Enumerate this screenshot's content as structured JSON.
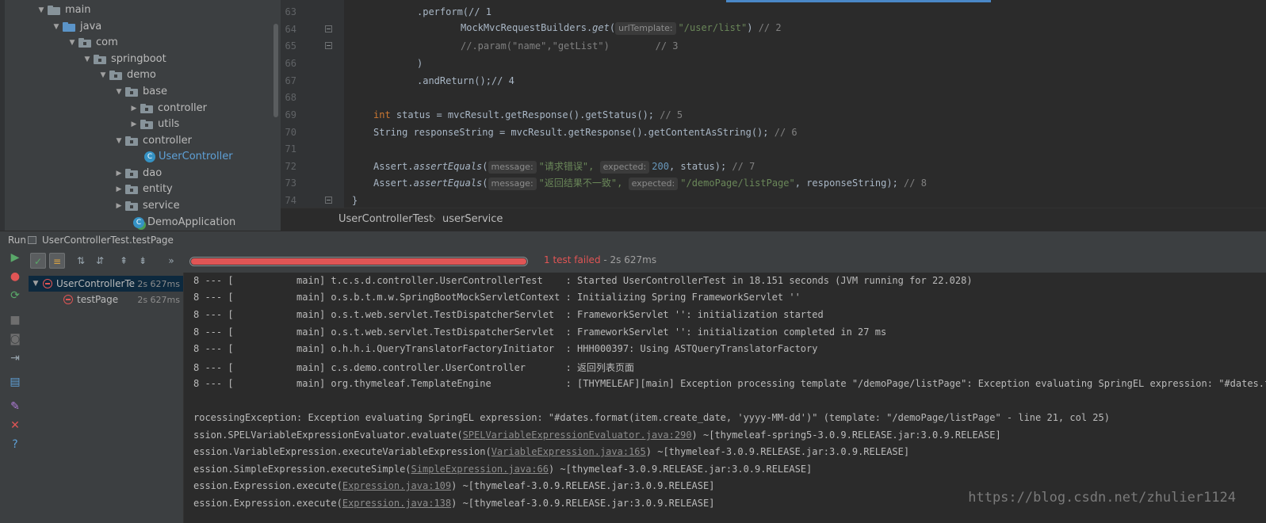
{
  "project_tree": {
    "items": [
      {
        "label": "main",
        "kind": "folder"
      },
      {
        "label": "java",
        "kind": "source"
      },
      {
        "label": "com",
        "kind": "package"
      },
      {
        "label": "springboot",
        "kind": "package"
      },
      {
        "label": "demo",
        "kind": "package"
      },
      {
        "label": "base",
        "kind": "package"
      },
      {
        "label": "controller",
        "kind": "package"
      },
      {
        "label": "utils",
        "kind": "package"
      },
      {
        "label": "controller",
        "kind": "package"
      },
      {
        "label": "UserController",
        "kind": "class"
      },
      {
        "label": "dao",
        "kind": "package"
      },
      {
        "label": "entity",
        "kind": "package"
      },
      {
        "label": "service",
        "kind": "package"
      },
      {
        "label": "DemoApplication",
        "kind": "app"
      }
    ]
  },
  "editor": {
    "line_numbers": [
      "63",
      "64",
      "65",
      "66",
      "67",
      "68",
      "69",
      "70",
      "71",
      "72",
      "73",
      "74"
    ],
    "code": {
      "l63": ".perform(// 1",
      "l64_a": "MockMvcRequestBuilders.",
      "l64_b": "get",
      "l64_c": "(",
      "l64_hint": "urlTemplate:",
      "l64_str": "\"/user/list\"",
      "l64_d": ") ",
      "l64_cmt": "// 2",
      "l65_cmt": "//.param(\"name\",\"getList\")        // 3",
      "l66": ")",
      "l67": ".andReturn();// 4",
      "l69_kw": "int",
      "l69_a": " status = mvcResult.getResponse().getStatus(); ",
      "l69_cmt": "// 5",
      "l70_a": "String responseString = mvcResult.getResponse().getContentAsString(); ",
      "l70_cmt": "// 6",
      "l72_a": "Assert.",
      "l72_b": "assertEquals",
      "l72_c": "(",
      "l72_hint1": "message:",
      "l72_str": "\"请求错误\",",
      "l72_hint2": "expected:",
      "l72_num": "200",
      "l72_d": ", status); ",
      "l72_cmt": "// 7",
      "l73_a": "Assert.",
      "l73_b": "assertEquals",
      "l73_c": "(",
      "l73_hint1": "message:",
      "l73_str": "\"返回结果不一致\",",
      "l73_hint2": "expected:",
      "l73_str2": "\"/demoPage/listPage\"",
      "l73_d": ", responseString); ",
      "l73_cmt": "// 8",
      "l74": "}"
    }
  },
  "breadcrumb": {
    "class_name": "UserControllerTest",
    "separator": "›",
    "member": "userService"
  },
  "run_panel": {
    "title": "Run",
    "config_name": "UserControllerTest.testPage",
    "status": "1 test failed",
    "status_time": " - 2s 627ms",
    "progress_fraction": 1.0,
    "tests": [
      {
        "name": "UserControllerTe",
        "time": "2s 627ms"
      },
      {
        "name": "testPage",
        "time": "2s 627ms"
      }
    ]
  },
  "console": {
    "lines": [
      "8 --- [           main] t.c.s.d.controller.UserControllerTest    : Started UserControllerTest in 18.151 seconds (JVM running for 22.028)",
      "8 --- [           main] o.s.b.t.m.w.SpringBootMockServletContext : Initializing Spring FrameworkServlet ''",
      "8 --- [           main] o.s.t.web.servlet.TestDispatcherServlet  : FrameworkServlet '': initialization started",
      "8 --- [           main] o.s.t.web.servlet.TestDispatcherServlet  : FrameworkServlet '': initialization completed in 27 ms",
      "8 --- [           main] o.h.h.i.QueryTranslatorFactoryInitiator  : HHH000397: Using ASTQueryTranslatorFactory",
      "8 --- [           main] c.s.demo.controller.UserController       : 返回列表页面",
      "8 --- [           main] org.thymeleaf.TemplateEngine             : [THYMELEAF][main] Exception processing template \"/demoPage/listPage\": Exception evaluating SpringEL expression: \"#dates.format",
      "",
      "rocessingException: Exception evaluating SpringEL expression: \"#dates.format(item.create_date, 'yyyy-MM-dd')\" (template: \"/demoPage/listPage\" - line 21, col 25)"
    ],
    "stack": [
      {
        "pre": "ssion.SPELVariableExpressionEvaluator.evaluate(",
        "link": "SPELVariableExpressionEvaluator.java:290",
        "post": ") ~[thymeleaf-spring5-3.0.9.RELEASE.jar:3.0.9.RELEASE]"
      },
      {
        "pre": "ession.VariableExpression.executeVariableExpression(",
        "link": "VariableExpression.java:165",
        "post": ") ~[thymeleaf-3.0.9.RELEASE.jar:3.0.9.RELEASE]"
      },
      {
        "pre": "ession.SimpleExpression.executeSimple(",
        "link": "SimpleExpression.java:66",
        "post": ") ~[thymeleaf-3.0.9.RELEASE.jar:3.0.9.RELEASE]"
      },
      {
        "pre": "ession.Expression.execute(",
        "link": "Expression.java:109",
        "post": ") ~[thymeleaf-3.0.9.RELEASE.jar:3.0.9.RELEASE]"
      },
      {
        "pre": "ession.Expression.execute(",
        "link": "Expression.java:138",
        "post": ") ~[thymeleaf-3.0.9.RELEASE.jar:3.0.9.RELEASE]"
      }
    ],
    "watermark": "https://blog.csdn.net/zhulier1124"
  },
  "colors": {
    "fail": "#e05555",
    "link": "#5ea0d6",
    "keyword": "#cc7832",
    "string": "#6a8759"
  }
}
